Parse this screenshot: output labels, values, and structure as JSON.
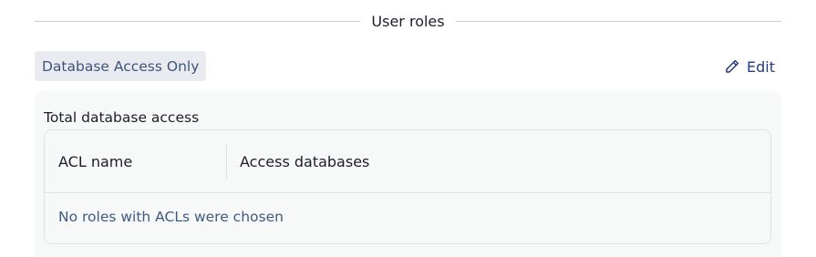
{
  "section": {
    "title": "User roles"
  },
  "role_chip": {
    "label": "Database Access Only"
  },
  "edit_button": {
    "label": "Edit",
    "icon": "pencil-icon"
  },
  "panel": {
    "label": "Total database access",
    "table": {
      "columns": [
        "ACL name",
        "Access databases"
      ],
      "empty_message": "No roles with ACLs were chosen"
    }
  },
  "colors": {
    "accent": "#24397e",
    "chip_bg": "#e9ebf1",
    "chip_text": "#3f5479",
    "panel_bg": "#f7f8f8",
    "border": "#dfe1e5",
    "muted_link": "#3f5a82"
  }
}
